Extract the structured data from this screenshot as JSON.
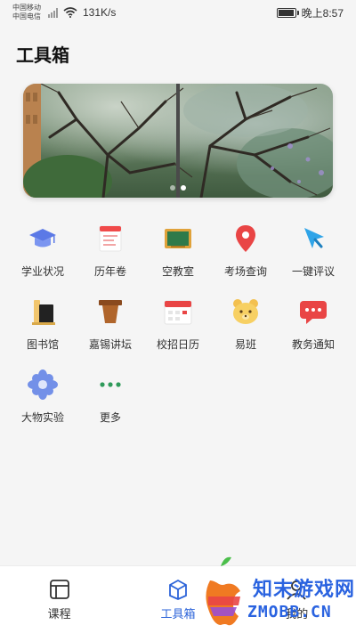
{
  "status_bar": {
    "carrier1": "中国移动",
    "carrier2": "中国电信",
    "speed": "131K/s",
    "time": "晚上8:57",
    "battery_level": 0.95
  },
  "page_title": "工具箱",
  "banner": {
    "slide_count": 2,
    "active_slide": 2
  },
  "tools": [
    {
      "label": "学业状况",
      "icon": "graduation-cap-icon"
    },
    {
      "label": "历年卷",
      "icon": "exam-paper-icon"
    },
    {
      "label": "空教室",
      "icon": "blackboard-icon"
    },
    {
      "label": "考场查询",
      "icon": "location-pin-icon"
    },
    {
      "label": "一键评议",
      "icon": "cursor-arrow-icon"
    },
    {
      "label": "图书馆",
      "icon": "library-books-icon"
    },
    {
      "label": "嘉锡讲坛",
      "icon": "podium-icon"
    },
    {
      "label": "校招日历",
      "icon": "calendar-icon"
    },
    {
      "label": "易班",
      "icon": "bear-icon"
    },
    {
      "label": "教务通知",
      "icon": "chat-bubble-icon"
    },
    {
      "label": "大物实验",
      "icon": "flower-icon"
    },
    {
      "label": "更多",
      "icon": "more-dots-icon"
    }
  ],
  "tabbar": {
    "tabs": [
      {
        "label": "课程",
        "icon": "schedule-icon",
        "active": false
      },
      {
        "label": "工具箱",
        "icon": "toolbox-icon",
        "active": true
      },
      {
        "label": "我的",
        "icon": "profile-icon",
        "active": false
      }
    ]
  },
  "watermark": {
    "line1": "知末游戏网",
    "line2": "ZMOBB.CN"
  },
  "colors": {
    "accent": "#2b63d9",
    "background": "#f5f5f5"
  }
}
